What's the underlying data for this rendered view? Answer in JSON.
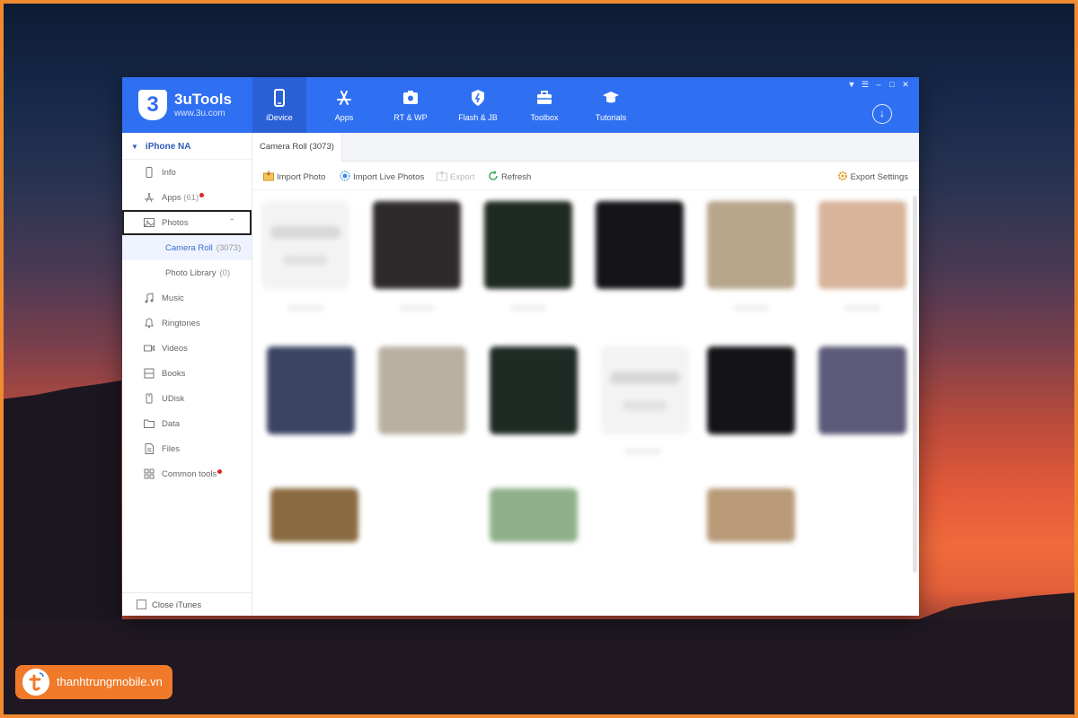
{
  "app": {
    "name": "3uTools",
    "url": "www.3u.com",
    "logo_char": "3"
  },
  "nav": {
    "tabs": [
      {
        "label": "iDevice",
        "icon": "phone-icon",
        "active": true
      },
      {
        "label": "Apps",
        "icon": "app-store-icon",
        "active": false
      },
      {
        "label": "RT & WP",
        "icon": "ringtone-wallpaper-icon",
        "active": false
      },
      {
        "label": "Flash & JB",
        "icon": "flash-jailbreak-icon",
        "active": false
      },
      {
        "label": "Toolbox",
        "icon": "toolbox-icon",
        "active": false
      },
      {
        "label": "Tutorials",
        "icon": "graduation-cap-icon",
        "active": false
      }
    ],
    "download_icon": "download-icon"
  },
  "window_controls": [
    "menu-icon",
    "list-icon",
    "minimize-icon",
    "maximize-icon",
    "close-icon"
  ],
  "sidebar": {
    "device_name": "iPhone NA",
    "items": [
      {
        "label": "Info",
        "icon": "phone-outline-icon"
      },
      {
        "label": "Apps",
        "count": "(61)",
        "icon": "app-store-icon",
        "badge": true
      },
      {
        "label": "Photos",
        "icon": "photo-icon",
        "expanded": true,
        "highlighted": true
      },
      {
        "label": "Music",
        "icon": "music-note-icon"
      },
      {
        "label": "Ringtones",
        "icon": "bell-icon"
      },
      {
        "label": "Videos",
        "icon": "video-camera-icon"
      },
      {
        "label": "Books",
        "icon": "book-icon"
      },
      {
        "label": "UDisk",
        "icon": "udisk-icon"
      },
      {
        "label": "Data",
        "icon": "folder-icon"
      },
      {
        "label": "Files",
        "icon": "file-icon"
      },
      {
        "label": "Common tools",
        "icon": "grid-tools-icon",
        "badge": true
      }
    ],
    "photo_subitems": [
      {
        "label": "Camera Roll",
        "count": "(3073)",
        "active": true
      },
      {
        "label": "Photo Library",
        "count": "(0)",
        "active": false
      }
    ],
    "close_itunes_label": "Close iTunes"
  },
  "main": {
    "tab_label": "Camera Roll (3073)",
    "toolbar": {
      "import_photo": "Import Photo",
      "import_live": "Import Live Photos",
      "export": "Export",
      "refresh": "Refresh",
      "export_settings": "Export Settings"
    }
  },
  "colors": {
    "accent": "#2f6ff2",
    "badge_red": "#e02424",
    "brand_orange": "#f07a2a"
  },
  "watermark": {
    "text": "thanhtrungmobile.vn"
  }
}
